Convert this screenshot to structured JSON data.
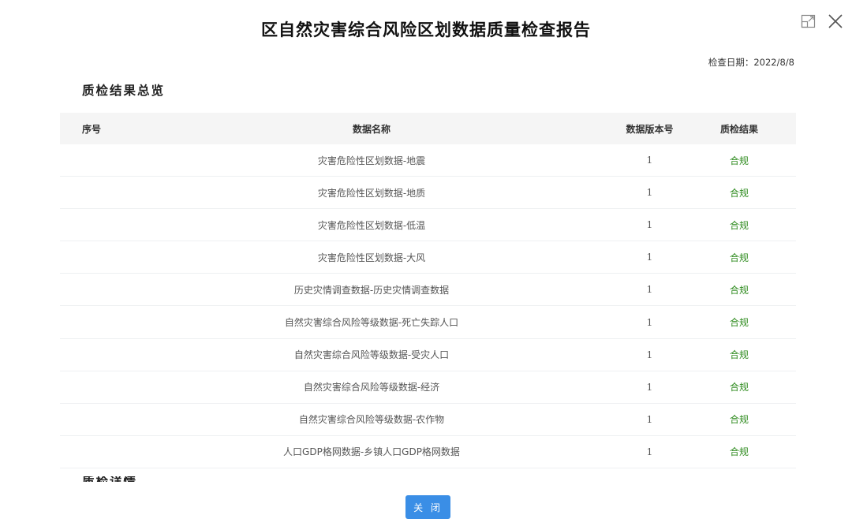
{
  "dialog": {
    "title": "区自然灾害综合风险区划数据质量检查报告",
    "check_date": "检查日期：2022/8/8",
    "close_label": "关 闭"
  },
  "overview": {
    "section_title": "质检结果总览",
    "headers": {
      "index": "序号",
      "name": "数据名称",
      "version": "数据版本号",
      "result": "质检结果"
    },
    "rows": [
      {
        "index": "",
        "name": "灾害危险性区划数据-地震",
        "version": "1",
        "result": "合规"
      },
      {
        "index": "",
        "name": "灾害危险性区划数据-地质",
        "version": "1",
        "result": "合规"
      },
      {
        "index": "",
        "name": "灾害危险性区划数据-低温",
        "version": "1",
        "result": "合规"
      },
      {
        "index": "",
        "name": "灾害危险性区划数据-大风",
        "version": "1",
        "result": "合规"
      },
      {
        "index": "",
        "name": "历史灾情调查数据-历史灾情调查数据",
        "version": "1",
        "result": "合规"
      },
      {
        "index": "",
        "name": "自然灾害综合风险等级数据-死亡失踪人口",
        "version": "1",
        "result": "合规"
      },
      {
        "index": "",
        "name": "自然灾害综合风险等级数据-受灾人口",
        "version": "1",
        "result": "合规"
      },
      {
        "index": "",
        "name": "自然灾害综合风险等级数据-经济",
        "version": "1",
        "result": "合规"
      },
      {
        "index": "",
        "name": "自然灾害综合风险等级数据-农作物",
        "version": "1",
        "result": "合规"
      },
      {
        "index": "",
        "name": "人口GDP格网数据-乡镇人口GDP格网数据",
        "version": "1",
        "result": "合规"
      }
    ]
  },
  "details": {
    "section_title": "质检详情"
  },
  "icons": {
    "maximize": "maximize-icon",
    "close": "close-icon"
  },
  "colors": {
    "compliant": "#2e8b1e",
    "primary_button": "#3a8ee6"
  }
}
